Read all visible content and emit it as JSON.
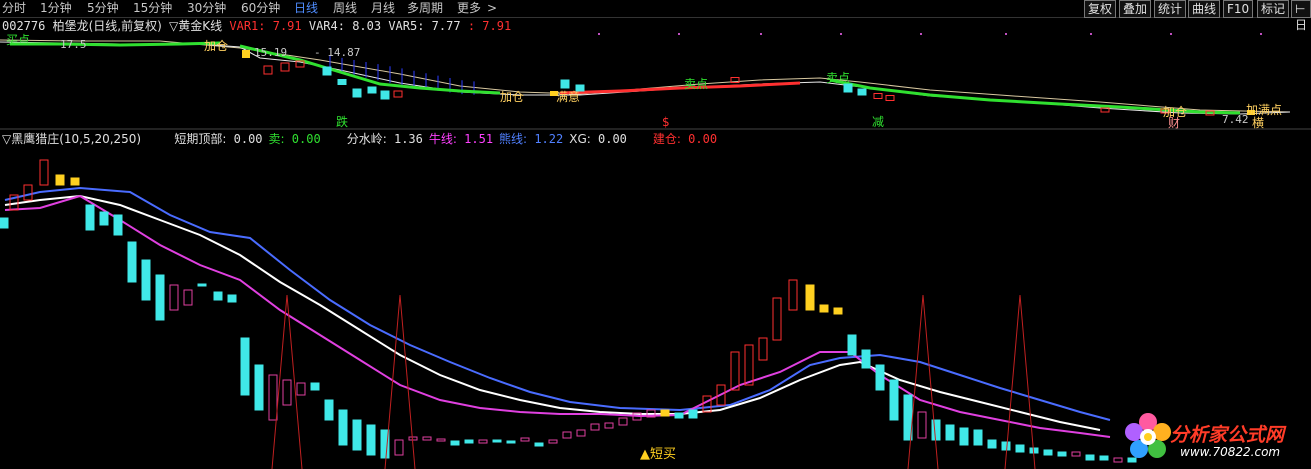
{
  "toolbar": {
    "timeframes": [
      "分时",
      "1分钟",
      "5分钟",
      "15分钟",
      "30分钟",
      "60分钟",
      "日线",
      "周线",
      "月线",
      "多周期",
      "更多",
      ">"
    ],
    "active_timeframe": "日线",
    "right_buttons": [
      "复权",
      "叠加",
      "统计",
      "曲线",
      "F10",
      "标记",
      "⊢日"
    ]
  },
  "main_panel": {
    "code": "002776",
    "name": "柏堡龙",
    "period_info": "(日线,前复权)",
    "indicator": "▽黄金K线",
    "vars": [
      {
        "label": "VAR1:",
        "value": "7.91",
        "color": "#ff3030"
      },
      {
        "label": "VAR4:",
        "value": "8.03",
        "color": "#e0e0e0"
      },
      {
        "label": "VAR5:",
        "value": "7.77",
        "color": "#e0e0e0"
      },
      {
        "label": ":",
        "value": "7.91",
        "color": "#ff3030"
      }
    ],
    "price_labels": [
      "17.5",
      "15.19",
      "14.87",
      "7.42"
    ],
    "annotations": [
      "买点",
      "加仓",
      "加仓",
      "满意",
      "卖点",
      "卖点",
      "跌",
      "$",
      "减",
      "加仓",
      "财",
      "加",
      "满点",
      "横"
    ]
  },
  "sub_panel": {
    "indicator": "▽黑鹰猎庄(10,5,20,250)",
    "fields": [
      {
        "label": "短期顶部:",
        "value": "0.00",
        "label_color": "#e0e0e0",
        "value_color": "#e0e0e0"
      },
      {
        "label": "卖:",
        "value": "0.00",
        "label_color": "#30e030",
        "value_color": "#30e030"
      },
      {
        "label": "分水岭:",
        "value": "1.36",
        "label_color": "#e0e0e0",
        "value_color": "#e0e0e0"
      },
      {
        "label": "牛线:",
        "value": "1.51",
        "label_color": "#ff40ff",
        "value_color": "#ff40ff"
      },
      {
        "label": "熊线:",
        "value": "1.22",
        "label_color": "#5080ff",
        "value_color": "#5080ff"
      },
      {
        "label": "XG:",
        "value": "0.00",
        "label_color": "#e0e0e0",
        "value_color": "#e0e0e0"
      },
      {
        "label": "建仓:",
        "value": "0.00",
        "label_color": "#ff3030",
        "value_color": "#ff3030"
      }
    ],
    "signal_label": "▲短买"
  },
  "watermark": {
    "text": "分析家公式网",
    "url": "www.70822.com"
  },
  "colors": {
    "background": "#000000",
    "up": "#ff3030",
    "down": "#40e8e8",
    "white_line": "#ffffff",
    "bull_line": "#e040e0",
    "bear_line": "#4a6cff",
    "yellow": "#ffd020",
    "green_trend": "#30e030",
    "blue_bars": "#2b3cff"
  }
}
